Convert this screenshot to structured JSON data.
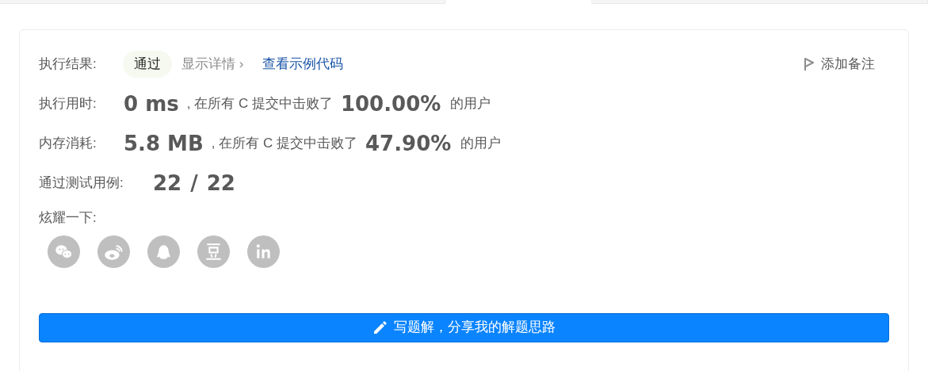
{
  "tabs": [
    {
      "selected": false
    },
    {
      "selected": true
    },
    {
      "selected": false
    }
  ],
  "result": {
    "label": "执行结果:",
    "status": "通过",
    "details_link": "显示详情",
    "caret": "›",
    "example_link": "查看示例代码",
    "note_button": "添加备注"
  },
  "stats": [
    {
      "label": "执行用时:",
      "value": "0 ms",
      "text": ", 在所有 C 提交中击败了",
      "percent": "100.00%",
      "suffix": "的用户"
    },
    {
      "label": "内存消耗:",
      "value": "5.8 MB",
      "text": ", 在所有 C 提交中击败了",
      "percent": "47.90%",
      "suffix": "的用户"
    }
  ],
  "tests": {
    "label": "通过测试用例:",
    "value": "22 / 22"
  },
  "share": {
    "label": "炫耀一下:",
    "icons": [
      {
        "kind": "wechat"
      },
      {
        "kind": "weibo"
      },
      {
        "kind": "qq"
      },
      {
        "kind": "douban"
      },
      {
        "kind": "linkedin"
      }
    ]
  },
  "write_button": "写题解，分享我的解题思路"
}
